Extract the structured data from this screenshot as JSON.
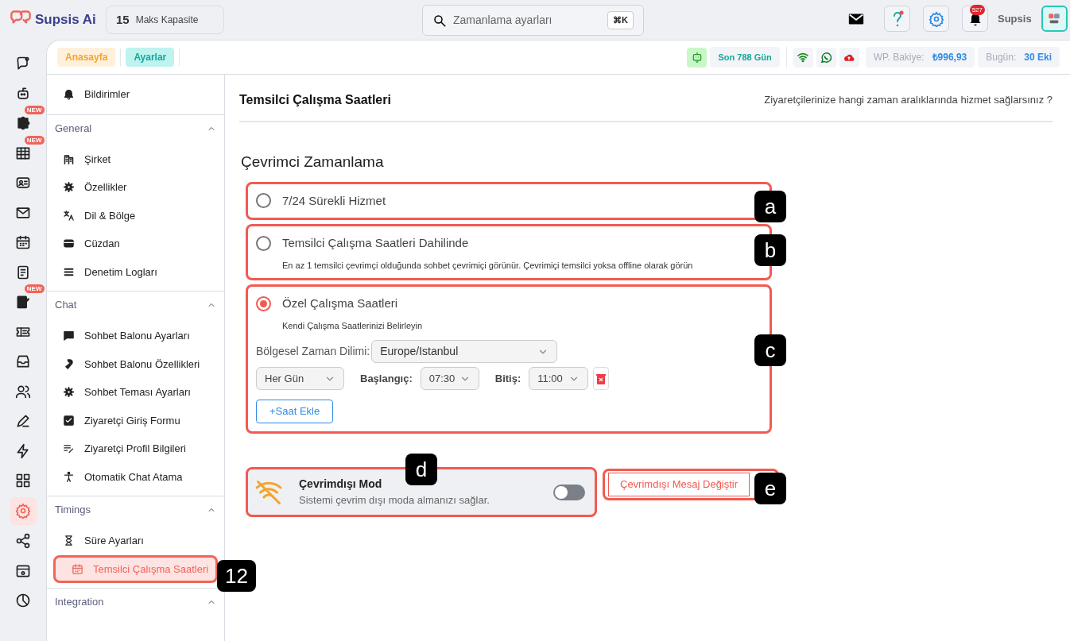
{
  "app": {
    "brand": "Supsis Ai",
    "capacity": {
      "value": "15",
      "label": "Maks Kapasite"
    }
  },
  "search": {
    "placeholder": "Zamanlama ayarları",
    "shortcut": "⌘K"
  },
  "header": {
    "notification_count": "527",
    "user": "Supsis"
  },
  "rail": [
    {
      "selected": false
    },
    {
      "selected": false
    },
    {
      "selected": false,
      "badge": "NEW"
    },
    {
      "selected": false,
      "badge": "NEW"
    },
    {
      "selected": false
    },
    {
      "selected": false
    },
    {
      "selected": false
    },
    {
      "selected": false
    },
    {
      "selected": false,
      "badge": "NEW"
    },
    {
      "selected": false
    },
    {
      "selected": false
    },
    {
      "selected": false
    },
    {
      "selected": false
    },
    {
      "selected": false
    },
    {
      "selected": false
    },
    {
      "selected": true
    },
    {
      "selected": false
    },
    {
      "selected": false
    },
    {
      "selected": false
    }
  ],
  "breadcrumbs": [
    "Anasayfa",
    "Ayarlar"
  ],
  "status": {
    "days": "Son 788 Gün",
    "balance_label": "WP. Bakiye:",
    "balance": "₺996,93",
    "today_label": "Bugün:",
    "today": "30 Eki"
  },
  "sidebar": {
    "top_item": {
      "label": "Bildirimler",
      "selected": false
    },
    "groups": [
      {
        "title": "General",
        "expanded": true,
        "items": [
          {
            "label": "Şirket",
            "selected": false
          },
          {
            "label": "Özellikler",
            "selected": false
          },
          {
            "label": "Dil & Bölge",
            "selected": false
          },
          {
            "label": "Cüzdan",
            "selected": false
          },
          {
            "label": "Denetim Logları",
            "selected": false
          }
        ]
      },
      {
        "title": "Chat",
        "expanded": true,
        "items": [
          {
            "label": "Sohbet Balonu Ayarları",
            "selected": false
          },
          {
            "label": "Sohbet Balonu Özellikleri",
            "selected": false
          },
          {
            "label": "Sohbet Teması Ayarları",
            "selected": false
          },
          {
            "label": "Ziyaretçi Giriş Formu",
            "selected": false
          },
          {
            "label": "Ziyaretçi Profil Bilgileri",
            "selected": false
          },
          {
            "label": "Otomatik Chat Atama",
            "selected": false
          }
        ]
      },
      {
        "title": "Timings",
        "expanded": true,
        "items": [
          {
            "label": "Süre Ayarları",
            "selected": false
          },
          {
            "label": "Temsilci Çalışma Saatleri",
            "selected": true
          }
        ]
      },
      {
        "title": "Integration",
        "expanded": true
      }
    ]
  },
  "page": {
    "title": "Temsilci Çalışma Saatleri",
    "subtitle": "Ziyaretçilerinize hangi zaman aralıklarında hizmet sağlarsınız ?",
    "section_title": "Çevrimci Zamanlama"
  },
  "options": [
    {
      "label": "7/24 Sürekli Hizmet",
      "selected": false
    },
    {
      "label": "Temsilci Çalışma Saatleri Dahilinde",
      "description": "En az 1 temsilci çevrimçi olduğunda sohbet çevrimiçi görünür. Çevrimiçi temsilci yoksa offline olarak görün",
      "selected": false
    },
    {
      "label": "Özel Çalışma Saatleri",
      "description": "Kendi Çalışma Saatlerinizi Belirleyin",
      "selected": true,
      "timezone": {
        "label": "Bölgesel Zaman Dilimi:",
        "value": "Europe/Istanbul"
      },
      "schedules": [
        {
          "day": "Her Gün",
          "start_label": "Başlangıç:",
          "start": "07:30",
          "end_label": "Bitiş:",
          "end": "11:00"
        }
      ],
      "add_button": "+Saat Ekle"
    }
  ],
  "offline_mode": {
    "title": "Çevrimdışı Mod",
    "description": "Sistemi çevrim dışı moda almanızı sağlar.",
    "on": false
  },
  "offline_message_button": "Çevrimdışı Mesaj Değiştir",
  "annotations": [
    {
      "label": "a"
    },
    {
      "label": "b"
    },
    {
      "label": "c"
    },
    {
      "label": "d"
    },
    {
      "label": "e"
    },
    {
      "label": "12"
    }
  ]
}
